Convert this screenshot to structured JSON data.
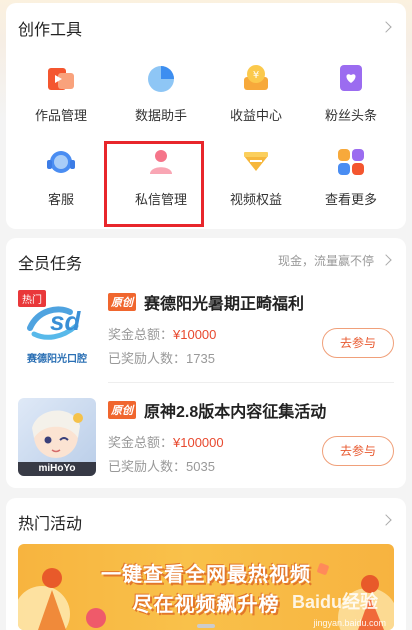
{
  "tools": {
    "title": "创作工具",
    "items": [
      {
        "label": "作品管理",
        "icon": "works-icon"
      },
      {
        "label": "数据助手",
        "icon": "pie-chart-icon"
      },
      {
        "label": "收益中心",
        "icon": "yuan-coin-icon"
      },
      {
        "label": "粉丝头条",
        "icon": "heart-card-icon"
      },
      {
        "label": "客服",
        "icon": "headset-icon"
      },
      {
        "label": "私信管理",
        "icon": "private-message-icon"
      },
      {
        "label": "视频权益",
        "icon": "diamond-icon"
      },
      {
        "label": "查看更多",
        "icon": "grid-icon"
      }
    ]
  },
  "tasks": {
    "title": "全员任务",
    "subtitle": "现金，流量赢不停",
    "items": [
      {
        "hot": "热门",
        "tag": "原创",
        "title": "赛德阳光暑期正畸福利",
        "prize_label": "奖金总额：",
        "prize": "¥10000",
        "winners_label": "已奖励人数：",
        "winners": "1735",
        "button": "去参与",
        "thumb_text": "赛德阳光口腔",
        "thumb_logo": "sd"
      },
      {
        "tag": "原创",
        "title": "原神2.8版本内容征集活动",
        "prize_label": "奖金总额：",
        "prize": "¥100000",
        "winners_label": "已奖励人数：",
        "winners": "5035",
        "button": "去参与",
        "thumb_text": "miHoYo"
      }
    ]
  },
  "activities": {
    "title": "热门活动",
    "banner_line1": "一键查看全网最热视频",
    "banner_line2": "尽在视频飙升榜",
    "watermark_big": "Baidu经验",
    "watermark": "jingyan.baidu.com"
  },
  "colors": {
    "accent": "#e8492f",
    "highlight": "#e8262b",
    "banner": "#f9c14a"
  }
}
